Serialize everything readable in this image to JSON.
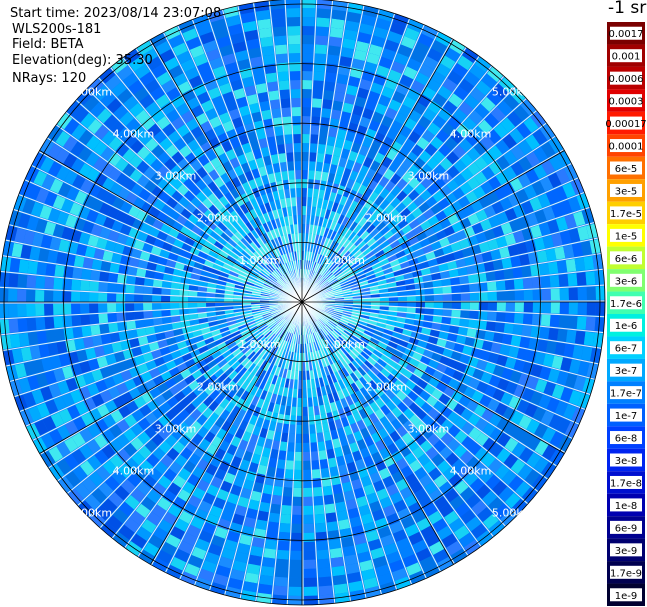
{
  "header": {
    "start_time": "Start time: 2023/08/14 23:07:08",
    "system": "WLS200s-181",
    "field": "Field: BETA",
    "elevation": "Elevation(deg): 35.30",
    "nrays": "NRays: 120"
  },
  "ring_labels": [
    "1.00km",
    "2.00km",
    "3.00km",
    "4.00km",
    "5.00km"
  ],
  "colorbar": {
    "title": "-1 sr",
    "levels": [
      {
        "label": "0.0017",
        "color": "#7a0000"
      },
      {
        "label": "0.001",
        "color": "#a00000"
      },
      {
        "label": "0.0006",
        "color": "#bb0000"
      },
      {
        "label": "0.0003",
        "color": "#e00000"
      },
      {
        "label": "0.00017",
        "color": "#ff1a00"
      },
      {
        "label": "0.0001",
        "color": "#ff4400"
      },
      {
        "label": "6e-5",
        "color": "#ff7000"
      },
      {
        "label": "3e-5",
        "color": "#ffa000"
      },
      {
        "label": "1.7e-5",
        "color": "#ffce00"
      },
      {
        "label": "1e-5",
        "color": "#ffff00"
      },
      {
        "label": "6e-6",
        "color": "#c0ff30"
      },
      {
        "label": "3e-6",
        "color": "#80ff70"
      },
      {
        "label": "1.7e-6",
        "color": "#40ffb0"
      },
      {
        "label": "1e-6",
        "color": "#00f0e0"
      },
      {
        "label": "6e-7",
        "color": "#00d0ff"
      },
      {
        "label": "3e-7",
        "color": "#00a8ff"
      },
      {
        "label": "1.7e-7",
        "color": "#0080ff"
      },
      {
        "label": "1e-7",
        "color": "#0060ff"
      },
      {
        "label": "6e-8",
        "color": "#0040ff"
      },
      {
        "label": "3e-8",
        "color": "#0024f0"
      },
      {
        "label": "1.7e-8",
        "color": "#0010d0"
      },
      {
        "label": "1e-8",
        "color": "#0000b0"
      },
      {
        "label": "6e-9",
        "color": "#000090"
      },
      {
        "label": "3e-9",
        "color": "#000070"
      },
      {
        "label": "1.7e-9",
        "color": "#000050"
      },
      {
        "label": "1e-9",
        "color": "#000030"
      }
    ]
  }
}
